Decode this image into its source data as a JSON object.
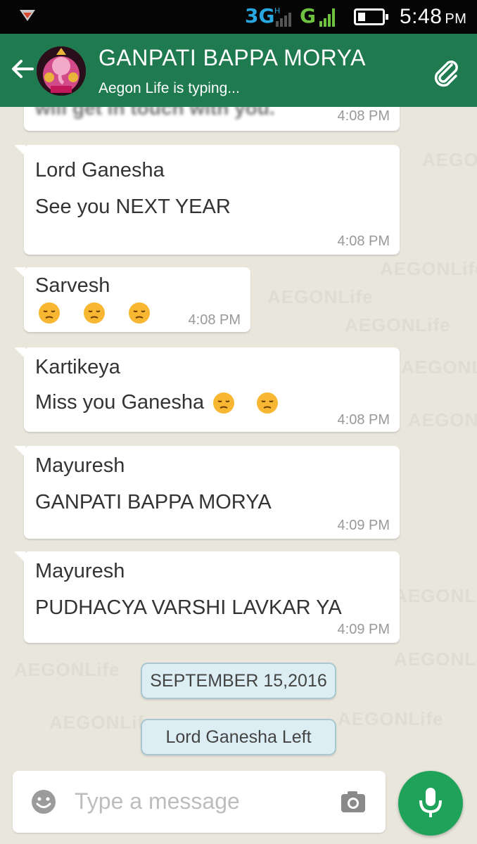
{
  "status_bar": {
    "network_1": "3G",
    "network_2": "G",
    "time": "5:48",
    "ampm": "PM"
  },
  "header": {
    "title": "GANPATI BAPPA MORYA",
    "subtitle": "Aegon Life is typing..."
  },
  "watermark_text": "AEGONLife",
  "messages": [
    {
      "sender": "",
      "text": "will get in touch with you.",
      "time": "4:08 PM"
    },
    {
      "sender": "Lord Ganesha",
      "text": "See you NEXT YEAR",
      "time": "4:08 PM"
    },
    {
      "sender": "Sarvesh",
      "text": "",
      "time": "4:08 PM"
    },
    {
      "sender": "Kartikeya",
      "text": "Miss you Ganesha",
      "time": "4:08 PM"
    },
    {
      "sender": "Mayuresh",
      "text": "GANPATI BAPPA MORYA",
      "time": "4:09 PM"
    },
    {
      "sender": "Mayuresh",
      "text": "PUDHACYA VARSHI LAVKAR YA",
      "time": "4:09 PM"
    }
  ],
  "system": {
    "date_chip": "SEPTEMBER 15,2016",
    "left_chip": "Lord Ganesha Left"
  },
  "input": {
    "placeholder": "Type a message"
  },
  "colors": {
    "header": "#1f7a4f",
    "mic": "#1fa35a",
    "chat_bg": "#e9e6dc"
  }
}
